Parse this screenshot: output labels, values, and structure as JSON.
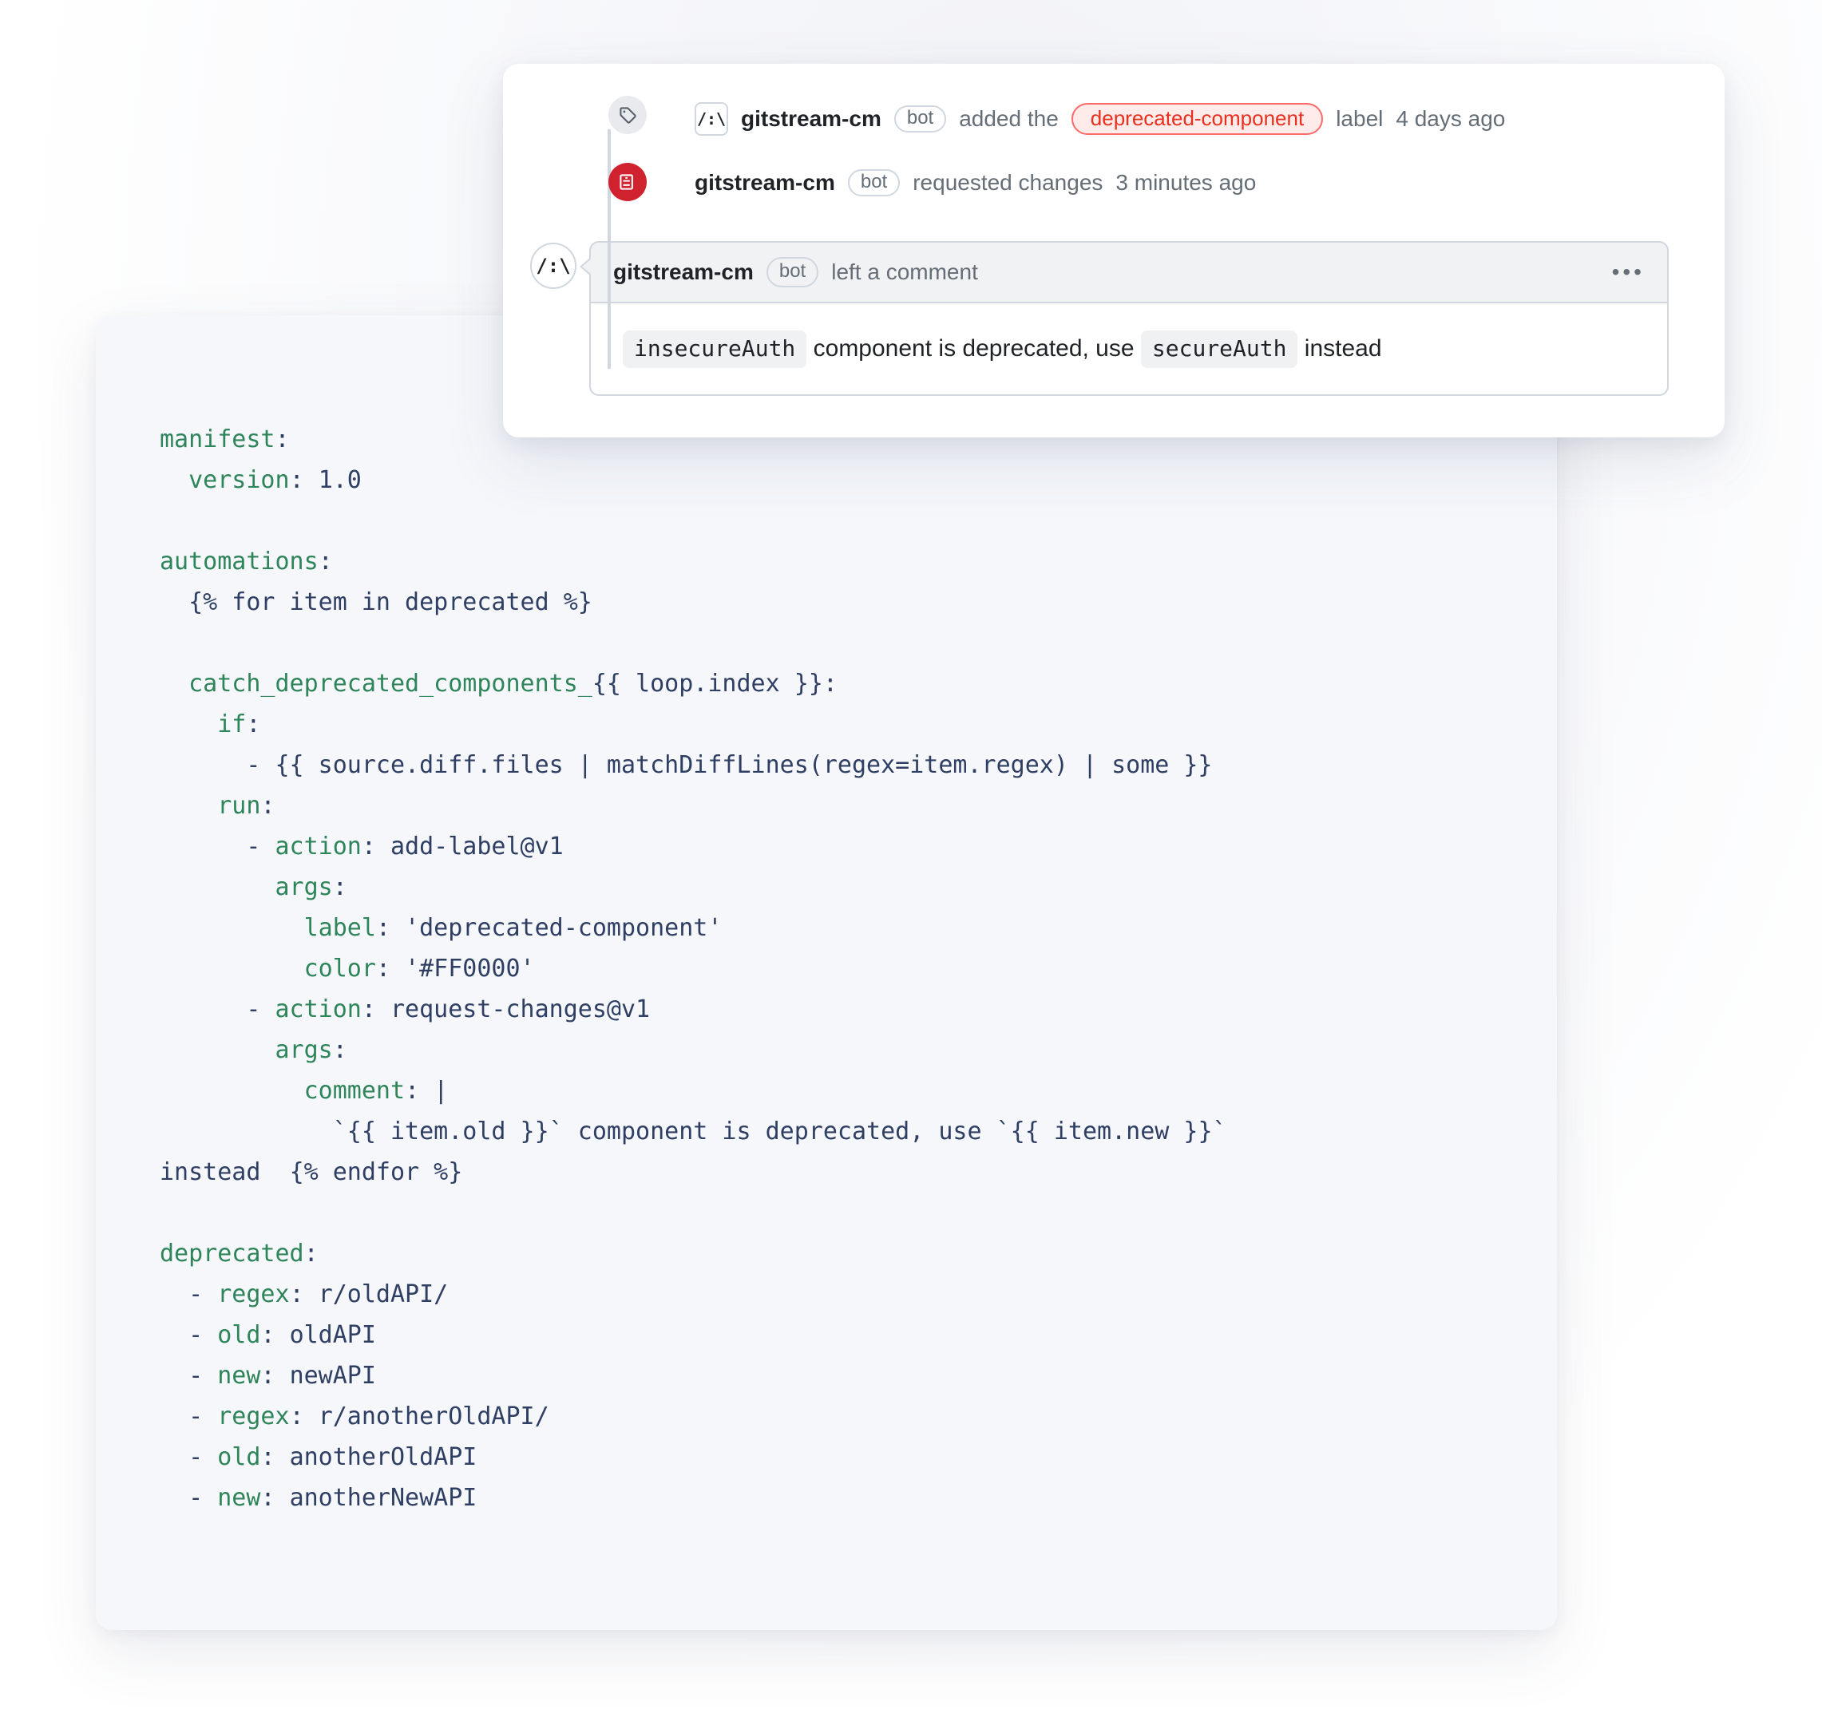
{
  "timeline": {
    "label_event": {
      "actor": "gitstream-cm",
      "bot_tag": "bot",
      "text_before_label": "added the",
      "label": "deprecated-component",
      "text_after_label": "label",
      "time": "4 days ago",
      "avatar_glyph": "/:\\"
    },
    "changes_event": {
      "actor": "gitstream-cm",
      "bot_tag": "bot",
      "text": "requested changes",
      "time": "3 minutes ago"
    },
    "comment_event": {
      "actor": "gitstream-cm",
      "bot_tag": "bot",
      "text": "left a comment",
      "avatar_glyph": "/:\\",
      "kebab": "•••",
      "body": {
        "code1": "insecureAuth",
        "mid1": " component is deprecated, use ",
        "code2": "secureAuth",
        "mid2": " instead"
      }
    }
  },
  "icons": {
    "tag": "tag-icon",
    "file_diff": "file-diff-icon"
  },
  "code": {
    "l01_key": "manifest",
    "l02_key": "version",
    "l02_val": "1.0",
    "l03_key": "automations",
    "l04_tpl": "{% for item in deprecated %}",
    "l05_key": "catch_deprecated_components_",
    "l05_tpl": "{{ loop.index }}",
    "l06_key": "if",
    "l07_tpl": "- {{ source.diff.files | matchDiffLines(regex=item.regex) | some }}",
    "l08_key": "run",
    "l09_key": "action",
    "l09_val": "add-label@v1",
    "l10_key": "args",
    "l11_key": "label",
    "l11_val": "'deprecated-component'",
    "l12_key": "color",
    "l12_val": "'#FF0000'",
    "l13_key": "action",
    "l13_val": "request-changes@v1",
    "l14_key": "args",
    "l15_key": "comment",
    "l15_val": "|",
    "l16_a": "`{{ item.old }}`",
    "l16_b": "component is deprecated, use",
    "l16_c": "`{{ item.new }}`",
    "l17_a": "instead",
    "l17_tpl": "{% endfor %}",
    "l18_key": "deprecated",
    "l19_key": "regex",
    "l19_val": "r/oldAPI/",
    "l20_key": "old",
    "l20_val": "oldAPI",
    "l21_key": "new",
    "l21_val": "newAPI",
    "l22_key": "regex",
    "l22_val": "r/anotherOldAPI/",
    "l23_key": "old",
    "l23_val": "anotherOldAPI",
    "l24_key": "new",
    "l24_val": "anotherNewAPI"
  }
}
